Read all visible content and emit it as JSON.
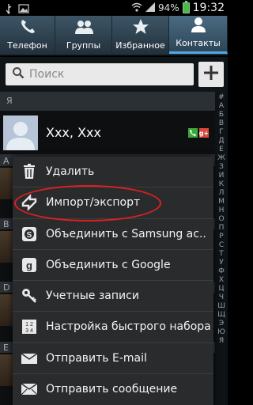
{
  "status_bar": {
    "battery": "94%",
    "time": "19:32"
  },
  "tabs": [
    {
      "label": "Телефон",
      "icon": "phone-icon",
      "active": false
    },
    {
      "label": "Группы",
      "icon": "groups-icon",
      "active": false
    },
    {
      "label": "Избранное",
      "icon": "star-icon",
      "active": false
    },
    {
      "label": "Контакты",
      "icon": "contact-icon",
      "active": true
    }
  ],
  "search": {
    "placeholder": "Поиск"
  },
  "contacts": {
    "section_letter": "Я",
    "items": [
      {
        "name": "Xxx, Xxx"
      }
    ],
    "partial_letters": [
      "A",
      "B",
      "D",
      "E"
    ]
  },
  "index_letters": [
    "#",
    "А",
    "Б",
    "В",
    "Г",
    "Д",
    "Е",
    "Ж",
    "З",
    "И",
    "К",
    "Л",
    "М",
    "Н",
    "О",
    "П",
    "Р",
    "С",
    "Т",
    "У",
    "Ф",
    "Х",
    "Ц",
    "Ч",
    "Ш",
    "Щ",
    "Э",
    "Ю",
    "Я"
  ],
  "menu": {
    "items": [
      {
        "label": "Удалить",
        "icon": "trash-icon"
      },
      {
        "label": "Импорт/экспорт",
        "icon": "import-export-icon",
        "highlighted": true
      },
      {
        "label": "Объединить с Samsung ac..",
        "icon": "samsung-icon"
      },
      {
        "label": "Объединить с Google",
        "icon": "google-icon"
      },
      {
        "label": "Учетные записи",
        "icon": "key-icon"
      },
      {
        "label": "Настройка быстрого набора",
        "icon": "speed-dial-icon"
      },
      {
        "label": "Отправить E-mail",
        "icon": "email-icon"
      },
      {
        "label": "Отправить сообщение",
        "icon": "message-icon"
      }
    ]
  },
  "colors": {
    "accent": "#55a6e6",
    "highlight": "#e02020",
    "phone_badge": "#3aa83a",
    "google_badge": "#d64a3a"
  }
}
